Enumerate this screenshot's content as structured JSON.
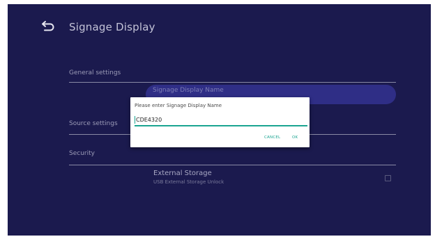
{
  "header": {
    "title": "Signage Display",
    "back_icon": "back-arrow-icon"
  },
  "sections": {
    "general": "General settings",
    "source": "Source settings",
    "security": "Security"
  },
  "selected_item": {
    "label": "Signage Display Name"
  },
  "external_storage": {
    "title": "External Storage",
    "subtitle": "USB External Storage Unlock",
    "checked": false
  },
  "dialog": {
    "title": "Please enter Signage Display Name",
    "input_value": "CDE4320",
    "cancel_label": "CANCEL",
    "ok_label": "OK"
  },
  "colors": {
    "background": "#1b1a4e",
    "highlight": "#2f2e86",
    "accent": "#1aa491"
  }
}
